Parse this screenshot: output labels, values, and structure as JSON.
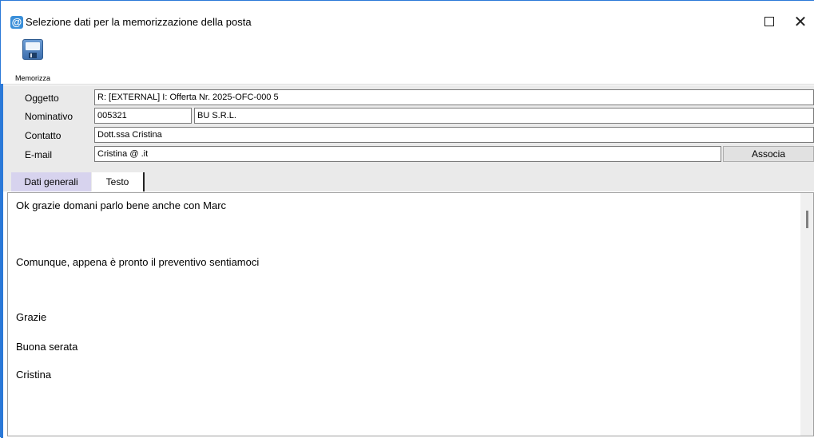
{
  "window": {
    "title": "Selezione dati per la memorizzazione della posta",
    "icon": "at-sign-icon",
    "maximize_icon": "maximize-icon",
    "close_glyph": "✕"
  },
  "toolbar": {
    "save_label": "Memorizza",
    "save_icon": "floppy-disk-icon"
  },
  "form": {
    "oggetto_label": "Oggetto",
    "oggetto_value": "R: [EXTERNAL] I: Offerta Nr. 2025-OFC-000        5",
    "nominativo_label": "Nominativo",
    "nominativo_code": "005321",
    "nominativo_name": "BU                              S.R.L.",
    "contatto_label": "Contatto",
    "contatto_value": "Dott.ssa Cristina",
    "email_label": "E-mail",
    "email_value": "Cristina            @            .it",
    "associa_label": "Associa"
  },
  "tabs": {
    "general": "Dati generali",
    "text": "Testo",
    "active": "Testo"
  },
  "message": {
    "line1": "Ok grazie domani parlo bene anche con Marc",
    "line2": "Comunque, appena è pronto il preventivo sentiamoci",
    "line3": "Grazie",
    "line4": "Buona serata",
    "line5": "Cristina"
  },
  "colors": {
    "accent": "#2b79d8",
    "form_bg": "#eaeaea",
    "tab_general_bg": "#d7d3ee"
  }
}
